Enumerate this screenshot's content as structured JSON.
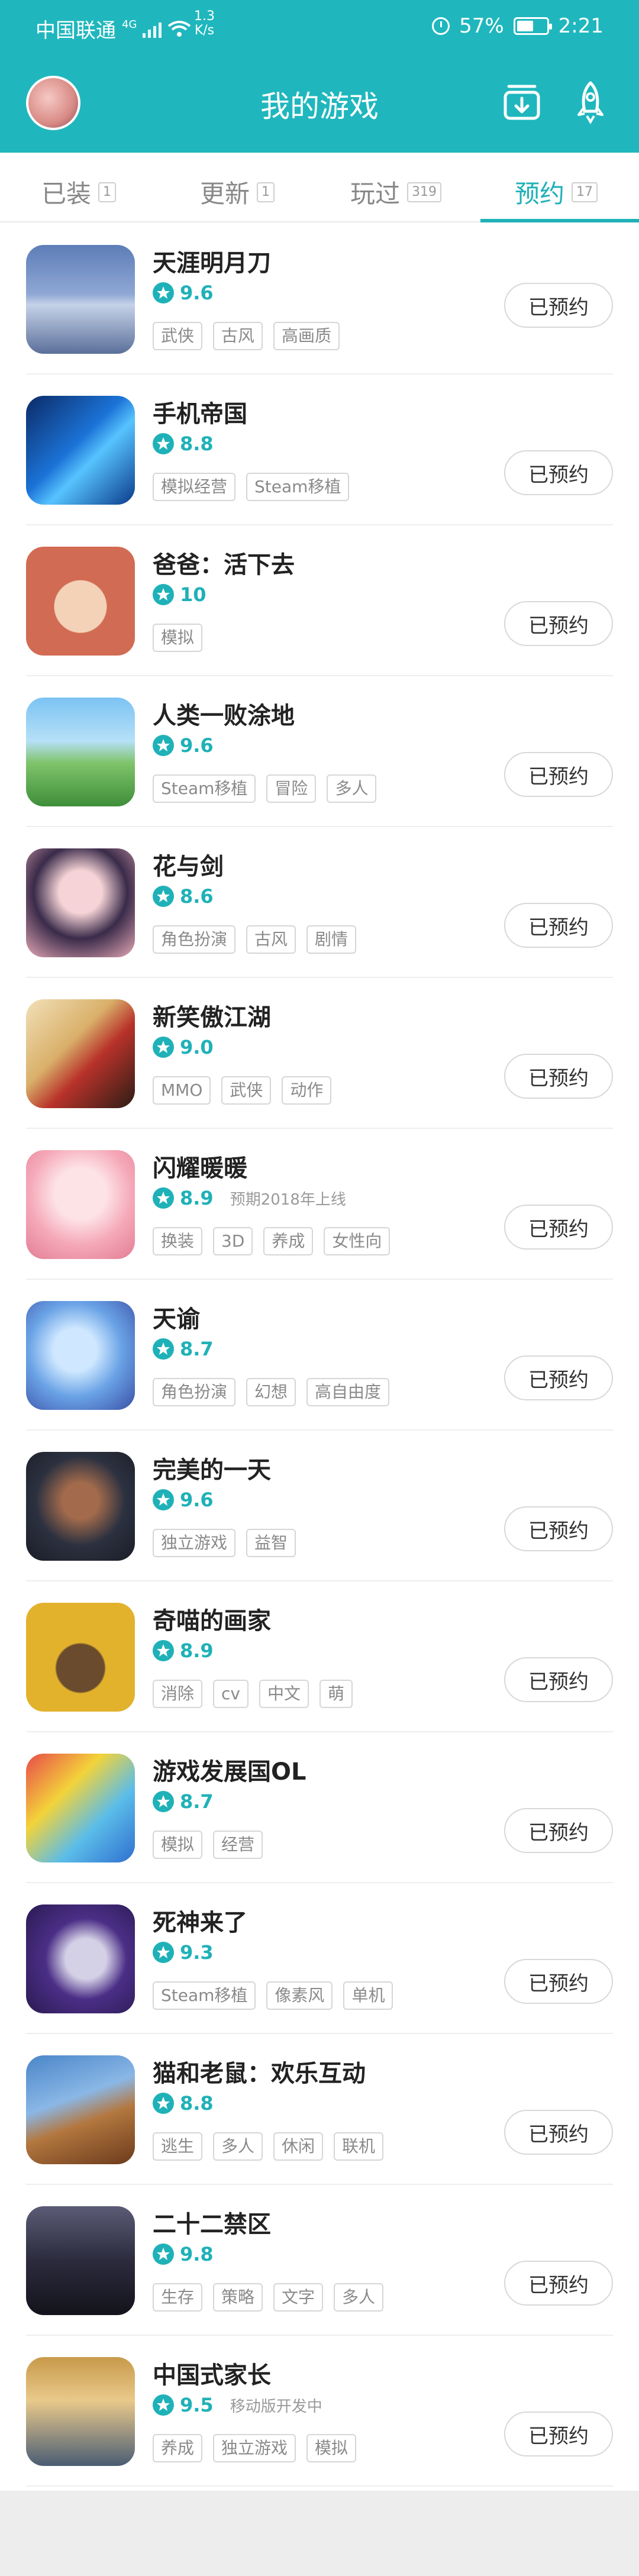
{
  "status_bar": {
    "carrier": "中国联通",
    "network": "4G",
    "speed_value": "1.3",
    "speed_unit": "K/s",
    "battery": "57%",
    "battery_level": 0.57,
    "time": "2:21"
  },
  "header": {
    "title": "我的游戏",
    "icons": [
      "download-icon",
      "rocket-icon"
    ]
  },
  "tabs": [
    {
      "label": "已装",
      "count": "1"
    },
    {
      "label": "更新",
      "count": "1"
    },
    {
      "label": "玩过",
      "count": "319"
    },
    {
      "label": "预约",
      "count": "17"
    }
  ],
  "active_tab": "预约",
  "accent_color": "#1fb1b8",
  "games": [
    {
      "name": "天涯明月刀",
      "score": "9.6",
      "note": "",
      "tags": [
        "武侠",
        "古风",
        "高画质"
      ],
      "button": "已预约"
    },
    {
      "name": "手机帝国",
      "score": "8.8",
      "note": "",
      "tags": [
        "模拟经营",
        "Steam移植"
      ],
      "button": "已预约"
    },
    {
      "name": "爸爸：活下去",
      "score": "10",
      "note": "",
      "tags": [
        "模拟"
      ],
      "button": "已预约"
    },
    {
      "name": "人类一败涂地",
      "score": "9.6",
      "note": "",
      "tags": [
        "Steam移植",
        "冒险",
        "多人"
      ],
      "button": "已预约"
    },
    {
      "name": "花与剑",
      "score": "8.6",
      "note": "",
      "tags": [
        "角色扮演",
        "古风",
        "剧情"
      ],
      "button": "已预约"
    },
    {
      "name": "新笑傲江湖",
      "score": "9.0",
      "note": "",
      "tags": [
        "MMO",
        "武侠",
        "动作"
      ],
      "button": "已预约"
    },
    {
      "name": "闪耀暖暖",
      "score": "8.9",
      "note": "预期2018年上线",
      "tags": [
        "换装",
        "3D",
        "养成",
        "女性向"
      ],
      "button": "已预约"
    },
    {
      "name": "天谕",
      "score": "8.7",
      "note": "",
      "tags": [
        "角色扮演",
        "幻想",
        "高自由度"
      ],
      "button": "已预约"
    },
    {
      "name": "完美的一天",
      "score": "9.6",
      "note": "",
      "tags": [
        "独立游戏",
        "益智"
      ],
      "button": "已预约"
    },
    {
      "name": "奇喵的画家",
      "score": "8.9",
      "note": "",
      "tags": [
        "消除",
        "cv",
        "中文",
        "萌"
      ],
      "button": "已预约"
    },
    {
      "name": "游戏发展国OL",
      "score": "8.7",
      "note": "",
      "tags": [
        "模拟",
        "经营"
      ],
      "button": "已预约"
    },
    {
      "name": "死神来了",
      "score": "9.3",
      "note": "",
      "tags": [
        "Steam移植",
        "像素风",
        "单机"
      ],
      "button": "已预约"
    },
    {
      "name": "猫和老鼠：欢乐互动",
      "score": "8.8",
      "note": "",
      "tags": [
        "逃生",
        "多人",
        "休闲",
        "联机"
      ],
      "button": "已预约"
    },
    {
      "name": "二十二禁区",
      "score": "9.8",
      "note": "",
      "tags": [
        "生存",
        "策略",
        "文字",
        "多人"
      ],
      "button": "已预约"
    },
    {
      "name": "中国式家长",
      "score": "9.5",
      "note": "移动版开发中",
      "tags": [
        "养成",
        "独立游戏",
        "模拟"
      ],
      "button": "已预约"
    }
  ],
  "icon_text": {
    "tianya": "天涯明月刀"
  }
}
